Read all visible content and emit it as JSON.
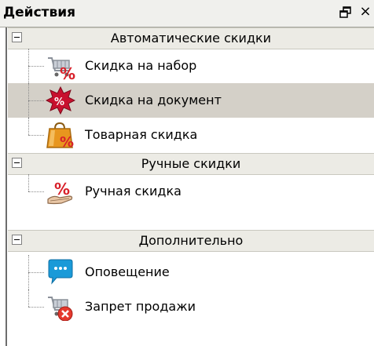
{
  "panel": {
    "title": "Действия",
    "float_glyph": "",
    "close_glyph": "×"
  },
  "groups": [
    {
      "label": "Автоматические скидки",
      "items": [
        {
          "label": "Скидка на набор",
          "icon": "discount-cart-icon"
        },
        {
          "label": "Скидка на документ",
          "icon": "discount-starburst-icon",
          "selected": true
        },
        {
          "label": "Товарная скидка",
          "icon": "discount-bag-icon"
        }
      ]
    },
    {
      "label": "Ручные скидки",
      "items": [
        {
          "label": "Ручная скидка",
          "icon": "discount-hand-icon"
        }
      ]
    },
    {
      "label": "Дополнительно",
      "items": [
        {
          "label": "Оповещение",
          "icon": "chat-bubble-icon"
        },
        {
          "label": "Запрет продажи",
          "icon": "cart-forbidden-icon"
        }
      ]
    }
  ],
  "colors": {
    "selected_bg": "#d4d0c8",
    "group_bg": "#ecebe5",
    "percent_red": "#d8202a",
    "bubble_blue": "#1a9ad8",
    "bag_orange": "#e8961e"
  }
}
